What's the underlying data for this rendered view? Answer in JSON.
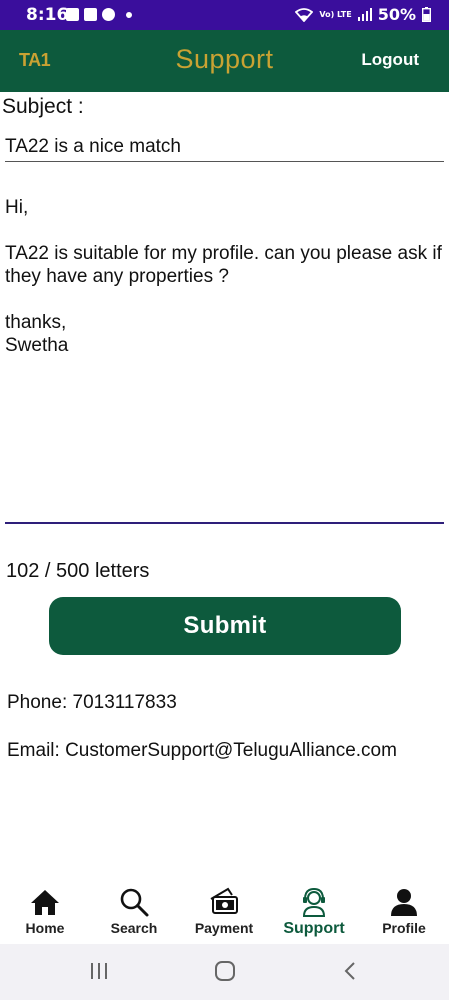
{
  "status_bar": {
    "time": "8:16",
    "network": "Vo) LTE",
    "battery": "50%"
  },
  "header": {
    "logo": "TA1",
    "title": "Support",
    "logout_label": "Logout"
  },
  "form": {
    "subject_label": "Subject :",
    "subject_value": "TA22 is a nice match",
    "message_value": "Hi,\n\nTA22 is suitable for my profile. can you please ask if they have any properties ?\n\nthanks,\nSwetha",
    "counter": "102 / 500 letters",
    "submit_label": "Submit"
  },
  "contact": {
    "phone": "Phone: 7013117833",
    "email": "Email: CustomerSupport@TeluguAlliance.com"
  },
  "bottom_nav": {
    "items": [
      {
        "label": "Home",
        "icon": "home-icon"
      },
      {
        "label": "Search",
        "icon": "search-icon"
      },
      {
        "label": "Payment",
        "icon": "payment-icon"
      },
      {
        "label": "Support",
        "icon": "support-icon",
        "active": true
      },
      {
        "label": "Profile",
        "icon": "profile-icon"
      }
    ]
  },
  "colors": {
    "status_bar": "#3a0e9c",
    "header": "#0d5a3d",
    "brand_gold": "#c9a233",
    "underline": "#2e1f7a"
  }
}
